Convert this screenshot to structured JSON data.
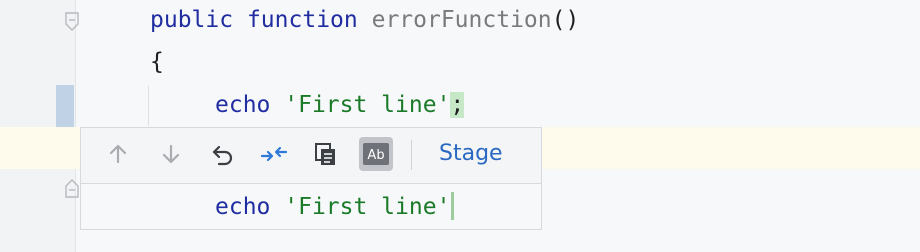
{
  "code": {
    "line1": {
      "keyword1": "public",
      "keyword2": "function",
      "function_name": "errorFunction",
      "parens": "()"
    },
    "line2": {
      "brace": "{"
    },
    "line3": {
      "keyword": "echo",
      "string": "'First line'",
      "semicolon": ";"
    }
  },
  "diff_popup": {
    "toolbar": {
      "buttons": [
        {
          "icon": "arrow-up-icon",
          "active": false
        },
        {
          "icon": "arrow-down-icon",
          "active": false
        },
        {
          "icon": "rollback-icon",
          "active": false
        },
        {
          "icon": "compare-icon",
          "active": false
        },
        {
          "icon": "copy-icon",
          "active": false
        },
        {
          "icon": "ab-toggle-icon",
          "label": "Ab",
          "active": true
        }
      ],
      "stage_label": "Stage"
    },
    "previous_content": {
      "keyword": "echo",
      "string": "'First line'"
    }
  },
  "colors": {
    "keyword": "#1f2da0",
    "string": "#1a7a28",
    "function_name": "#7a7a7a",
    "link": "#2a69c2",
    "change_marker": "#bfd2e6",
    "current_line": "#fefbec"
  }
}
